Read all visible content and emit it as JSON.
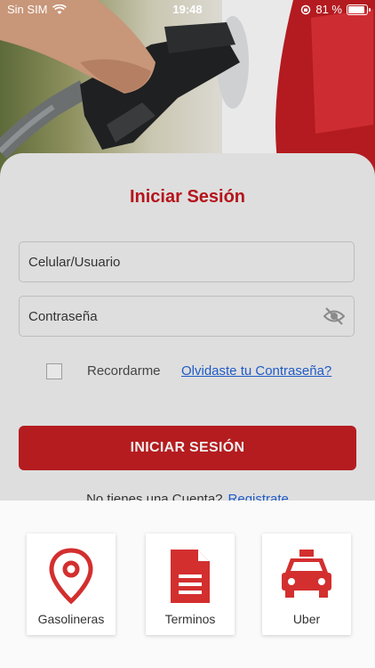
{
  "status_bar": {
    "carrier": "Sin SIM",
    "time": "19:48",
    "battery": "81 %",
    "battery_level": 0.81
  },
  "login": {
    "title": "Iniciar Sesión",
    "user_placeholder": "Celular/Usuario",
    "password_placeholder": "Contraseña",
    "remember_label": "Recordarme",
    "forgot_link": "Olvidaste tu Contraseña?",
    "submit_label": "INICIAR SESIÓN",
    "no_account_text": "No tienes una Cuenta?",
    "register_link": "Registrate"
  },
  "bottom_menu": [
    {
      "label": "Gasolineras",
      "icon": "map-pin-icon"
    },
    {
      "label": "Terminos",
      "icon": "document-icon"
    },
    {
      "label": "Uber",
      "icon": "taxi-icon"
    }
  ],
  "colors": {
    "accent": "#b51c1f",
    "link": "#1f5bc7",
    "icon_red": "#d32f2f"
  }
}
